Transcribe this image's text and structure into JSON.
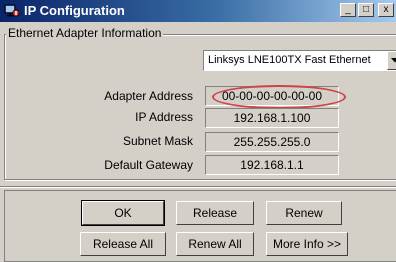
{
  "window": {
    "title": "IP Configuration",
    "min_glyph": "_",
    "max_glyph": "□",
    "close_glyph": "x"
  },
  "group": {
    "label": "Ethernet  Adapter Information"
  },
  "adapter_select": {
    "selected": "Linksys LNE100TX Fast Ethernet"
  },
  "fields": [
    {
      "label": "Adapter Address",
      "value": "00-00-00-00-00-00"
    },
    {
      "label": "IP Address",
      "value": "192.168.1.100"
    },
    {
      "label": "Subnet Mask",
      "value": "255.255.255.0"
    },
    {
      "label": "Default Gateway",
      "value": "192.168.1.1"
    }
  ],
  "buttons": {
    "ok": "OK",
    "release": "Release",
    "renew": "Renew",
    "release_all": "Release All",
    "renew_all": "Renew All",
    "more_info": "More Info >>"
  },
  "colors": {
    "highlight_oval": "#cc4444",
    "titlebar_start": "#0a246a"
  }
}
